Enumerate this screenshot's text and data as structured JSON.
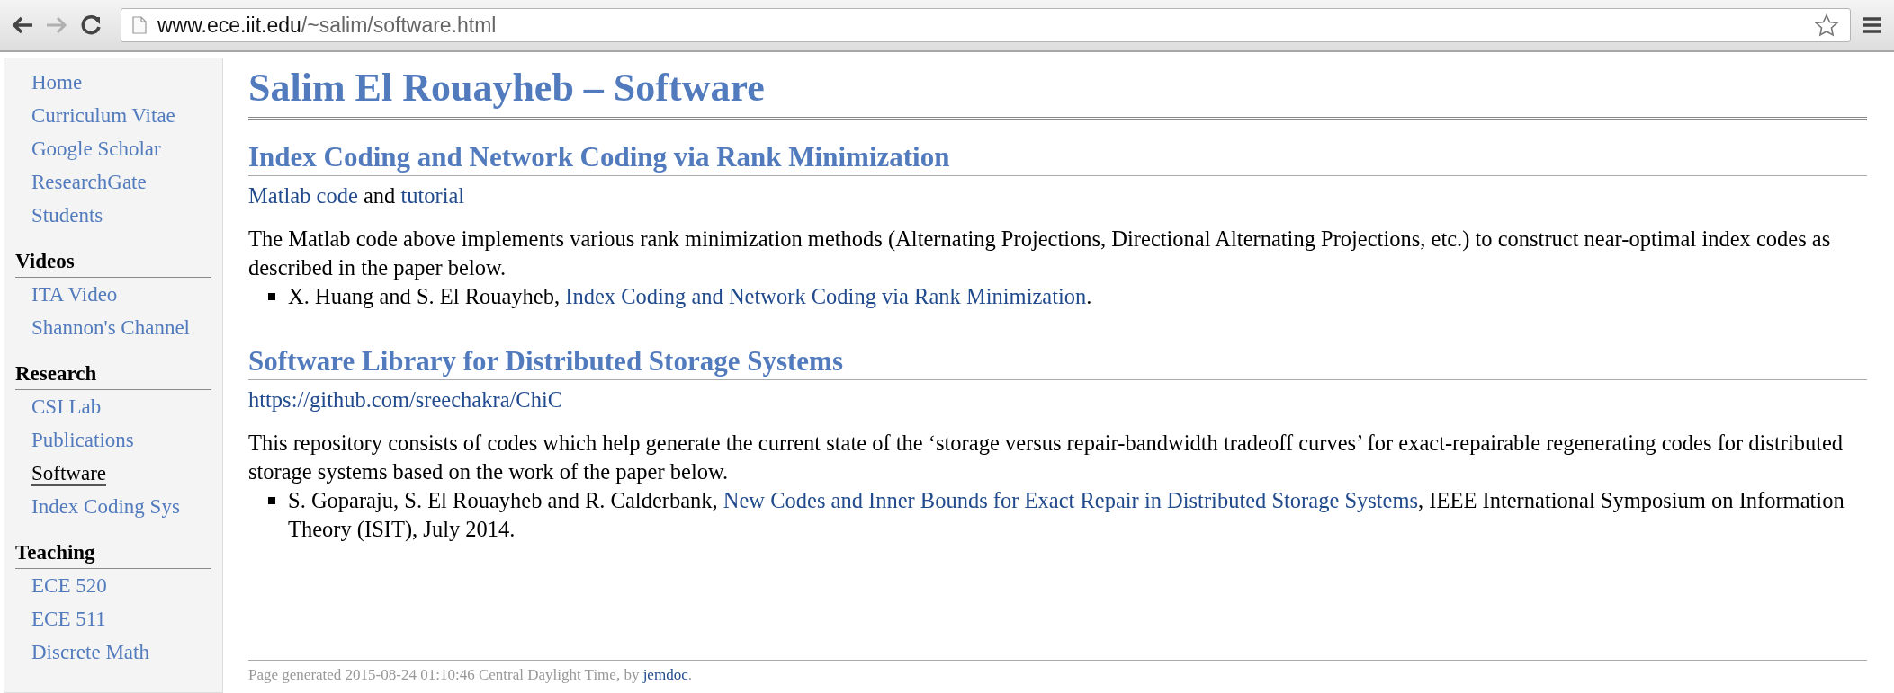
{
  "browser": {
    "url_host": "www.ece.iit.edu",
    "url_path": "/~salim/software.html",
    "forward_disabled": true
  },
  "sidebar": {
    "groups": [
      {
        "items": [
          {
            "label": "Home",
            "selected": false
          },
          {
            "label": "Curriculum Vitae",
            "selected": false
          },
          {
            "label": "Google Scholar",
            "selected": false
          },
          {
            "label": "ResearchGate",
            "selected": false
          },
          {
            "label": "Students",
            "selected": false
          }
        ]
      },
      {
        "heading": "Videos",
        "items": [
          {
            "label": "ITA Video",
            "selected": false
          },
          {
            "label": "Shannon's Channel",
            "selected": false
          }
        ]
      },
      {
        "heading": "Research",
        "items": [
          {
            "label": "CSI Lab",
            "selected": false
          },
          {
            "label": "Publications",
            "selected": false
          },
          {
            "label": "Software",
            "selected": true
          },
          {
            "label": "Index Coding Sys",
            "selected": false
          }
        ]
      },
      {
        "heading": "Teaching",
        "items": [
          {
            "label": "ECE 520",
            "selected": false
          },
          {
            "label": "ECE 511",
            "selected": false
          },
          {
            "label": "Discrete Math",
            "selected": false
          }
        ]
      }
    ]
  },
  "page": {
    "title": "Salim El Rouayheb – Software",
    "sections": [
      {
        "heading": "Index Coding and Network Coding via Rank Minimization",
        "links_line": [
          {
            "kind": "link",
            "text": "Matlab code"
          },
          {
            "kind": "text",
            "text": " and "
          },
          {
            "kind": "link",
            "text": "tutorial"
          }
        ],
        "description": "The Matlab code above implements various rank minimization methods (Alternating Projections, Directional Alternating Projections, etc.) to construct near-optimal index codes as described in the paper below.",
        "references": [
          [
            {
              "kind": "text",
              "text": "X. Huang and S. El Rouayheb, "
            },
            {
              "kind": "link",
              "text": "Index Coding and Network Coding via Rank Minimization"
            },
            {
              "kind": "text",
              "text": "."
            }
          ]
        ]
      },
      {
        "heading": "Software Library for Distributed Storage Systems",
        "links_line": [
          {
            "kind": "link",
            "text": "https://github.com/sreechakra/ChiC"
          }
        ],
        "description": "This repository consists of codes which help generate the current state of the ‘storage versus repair-bandwidth tradeoff curves’ for exact-repairable regenerating codes for distributed storage systems based on the work of the paper below.",
        "references": [
          [
            {
              "kind": "text",
              "text": "S. Goparaju, S. El Rouayheb and R. Calderbank, "
            },
            {
              "kind": "link",
              "text": "New Codes and Inner Bounds for Exact Repair in Distributed Storage Systems"
            },
            {
              "kind": "text",
              "text": ", IEEE International Symposium on Information Theory (ISIT), July 2014."
            }
          ]
        ]
      }
    ],
    "footer": [
      {
        "kind": "text",
        "text": "Page generated 2015-08-24 01:10:46 Central Daylight Time, by "
      },
      {
        "kind": "link",
        "text": "jemdoc"
      },
      {
        "kind": "text",
        "text": "."
      }
    ]
  }
}
